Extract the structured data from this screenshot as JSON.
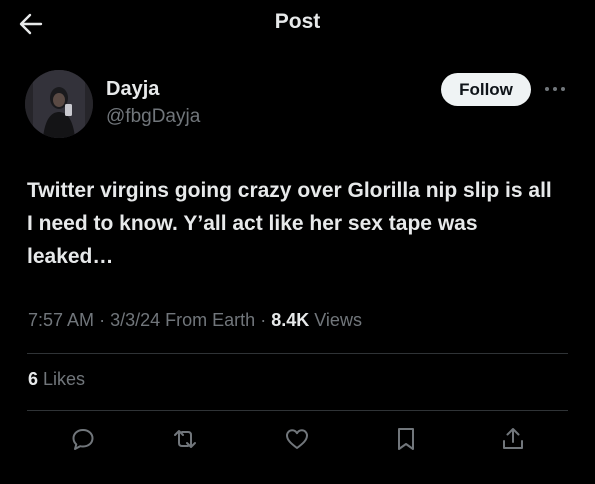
{
  "header": {
    "title": "Post",
    "back_icon": "arrow-left-icon"
  },
  "author": {
    "name": "Dayja",
    "handle": "@fbgDayja",
    "follow_label": "Follow",
    "more_icon": "more-horizontal-icon"
  },
  "tweet": {
    "text": "Twitter virgins going crazy over Glorilla nip slip is all I need to know. Y’all act like her sex tape was leaked…",
    "time": "7:57 AM",
    "date": "3/3/24",
    "location": "From Earth",
    "views_count": "8.4K",
    "views_label": "Views",
    "separator": "·"
  },
  "engagement": {
    "likes_count": "6",
    "likes_label": "Likes"
  },
  "actions": [
    {
      "icon": "reply-icon"
    },
    {
      "icon": "repost-icon"
    },
    {
      "icon": "like-icon"
    },
    {
      "icon": "bookmark-icon"
    },
    {
      "icon": "share-icon"
    }
  ],
  "colors": {
    "background": "#000000",
    "text_primary": "#e7e9ea",
    "text_secondary": "#71767b",
    "divider": "#2f3336",
    "follow_bg": "#eff3f4"
  }
}
